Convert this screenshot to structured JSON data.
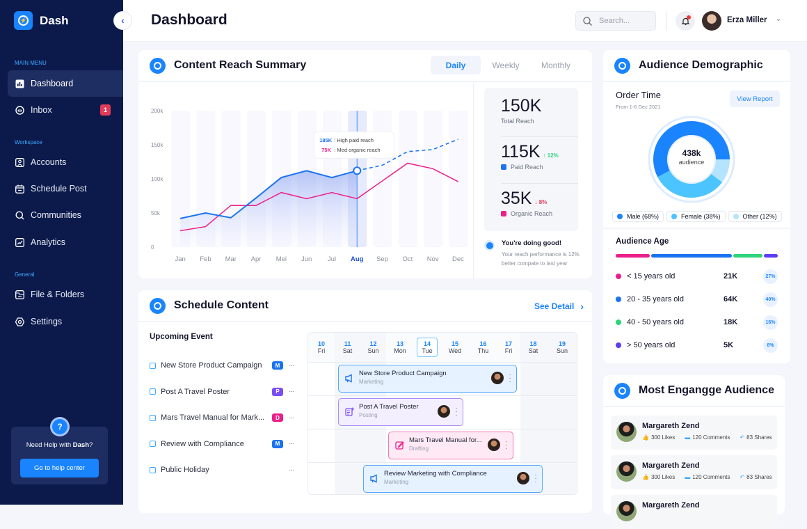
{
  "app": {
    "name": "Dash"
  },
  "sidebar": {
    "main_menu_label": "MAIN MENU",
    "workspace_label": "Workspace",
    "general_label": "General",
    "items": [
      {
        "label": "Dashboard",
        "icon": "chart-bar-icon",
        "active": true
      },
      {
        "label": "Inbox",
        "icon": "chat-icon",
        "badge": "1"
      },
      {
        "label": "Accounts",
        "icon": "user-card-icon"
      },
      {
        "label": "Schedule Post",
        "icon": "calendar-icon"
      },
      {
        "label": "Communities",
        "icon": "search-icon"
      },
      {
        "label": "Analytics",
        "icon": "line-chart-icon"
      },
      {
        "label": "File & Folders",
        "icon": "folder-icon"
      },
      {
        "label": "Settings",
        "icon": "gear-icon"
      }
    ],
    "help": {
      "text_prefix": "Need Help with ",
      "text_brand": "Dash",
      "text_suffix": "?",
      "button": "Go to help center"
    }
  },
  "header": {
    "title": "Dashboard",
    "search_placeholder": "Search...",
    "user_name": "Erza Miller"
  },
  "reach": {
    "title": "Content Reach Summary",
    "tabs": [
      "Daily",
      "Weekly",
      "Monthly"
    ],
    "active_tab": "Daily",
    "total": {
      "value": "150K",
      "label": "Total Reach"
    },
    "paid": {
      "value": "115K",
      "label": "Paid Reach",
      "change": "12%",
      "direction": "up"
    },
    "organic": {
      "value": "35K",
      "label": "Organic Reach",
      "change": "8%",
      "direction": "down"
    },
    "message": {
      "title": "You're doing good!",
      "text": "Your reach performance is 12% better compate to last year"
    },
    "tooltip": {
      "paid_value": "185K",
      "paid_label": ": High paid reach",
      "organic_value": "75K",
      "organic_label": ": Med organic reach"
    }
  },
  "chart_data": {
    "type": "line",
    "x": [
      "Jan",
      "Feb",
      "Mar",
      "Apr",
      "Mei",
      "Jun",
      "Jul",
      "Aug",
      "Sep",
      "Oct",
      "Nov",
      "Dec"
    ],
    "highlight": "Aug",
    "yticks": [
      "0",
      "50k",
      "100k",
      "150k",
      "200k"
    ],
    "ylim": [
      0,
      200000
    ],
    "series": [
      {
        "name": "Paid reach",
        "color": "#1a73f0",
        "values": [
          42000,
          50000,
          43000,
          72000,
          102000,
          112000,
          102000,
          112000,
          120000,
          140000,
          143000,
          158000
        ],
        "dashed_from_index": 7
      },
      {
        "name": "Organic reach",
        "color": "#ec1e8a",
        "values": [
          24000,
          30000,
          61000,
          61000,
          80000,
          71000,
          80000,
          71000,
          97000,
          123000,
          115000,
          96000
        ]
      }
    ]
  },
  "demographic": {
    "title": "Audience Demographic",
    "subtitle": "Order Time",
    "date": "From 1-6 Dec 2021",
    "view_report": "View Report",
    "center_value": "438k",
    "center_label": "audience",
    "segments": [
      {
        "label": "Male (68%)",
        "value": 68,
        "color": "#1a84ff"
      },
      {
        "label": "Female (38%)",
        "value": 38,
        "color": "#4cc4ff"
      },
      {
        "label": "Other (12%)",
        "value": 12,
        "color": "#b4e4ff"
      }
    ]
  },
  "age": {
    "title": "Audience Age",
    "rows": [
      {
        "label": "< 15 years old",
        "value": "21K",
        "pct": "27%",
        "color": "#ec1e8a"
      },
      {
        "label": "20 - 35 years old",
        "value": "64K",
        "pct": "40%",
        "color": "#1a73f0"
      },
      {
        "label": "40 - 50 years old",
        "value": "18K",
        "pct": "16%",
        "color": "#2ed47a"
      },
      {
        "label": "> 50 years old",
        "value": "5K",
        "pct": "8%",
        "color": "#5b3df5"
      }
    ]
  },
  "engaged": {
    "title": "Most Engangge Audience",
    "items": [
      {
        "name": "Margareth Zend",
        "likes": "300 Likes",
        "comments": "120 Comments",
        "shares": "83 Shares"
      },
      {
        "name": "Margareth Zend",
        "likes": "300 Likes",
        "comments": "120 Comments",
        "shares": "83 Shares"
      },
      {
        "name": "Margareth Zend"
      }
    ]
  },
  "schedule": {
    "title": "Schedule Content",
    "see_detail": "See Detail",
    "upcoming_title": "Upcoming Event",
    "events": [
      {
        "title": "New Store Product Campaign",
        "tag": "M",
        "tag_color": "#1a73f0"
      },
      {
        "title": "Post A Travel Poster",
        "tag": "P",
        "tag_color": "#7b4df5"
      },
      {
        "title": "Mars Travel Manual for Mark...",
        "tag": "D",
        "tag_color": "#ec1e8a"
      },
      {
        "title": "Review with Compliance",
        "tag": "M",
        "tag_color": "#1a73f0"
      },
      {
        "title": "Public Holiday",
        "tag": ""
      }
    ],
    "days": [
      {
        "n": "10",
        "w": "Fri"
      },
      {
        "n": "11",
        "w": "Sat"
      },
      {
        "n": "12",
        "w": "Sun"
      },
      {
        "n": "13",
        "w": "Mon"
      },
      {
        "n": "14",
        "w": "Tue",
        "today": true
      },
      {
        "n": "15",
        "w": "Wed"
      },
      {
        "n": "16",
        "w": "Thu"
      },
      {
        "n": "17",
        "w": "Fri"
      },
      {
        "n": "18",
        "w": "Sat"
      },
      {
        "n": "19",
        "w": "Sun"
      }
    ],
    "cards": [
      {
        "title": "New Store Product Campaign",
        "category": "Marketing"
      },
      {
        "title": "Post A Travel Poster",
        "category": "Posting"
      },
      {
        "title": "Mars Travel Manual for...",
        "category": "Drafting"
      },
      {
        "title": "Review Marketing with Compliance",
        "category": "Marketing"
      }
    ]
  }
}
